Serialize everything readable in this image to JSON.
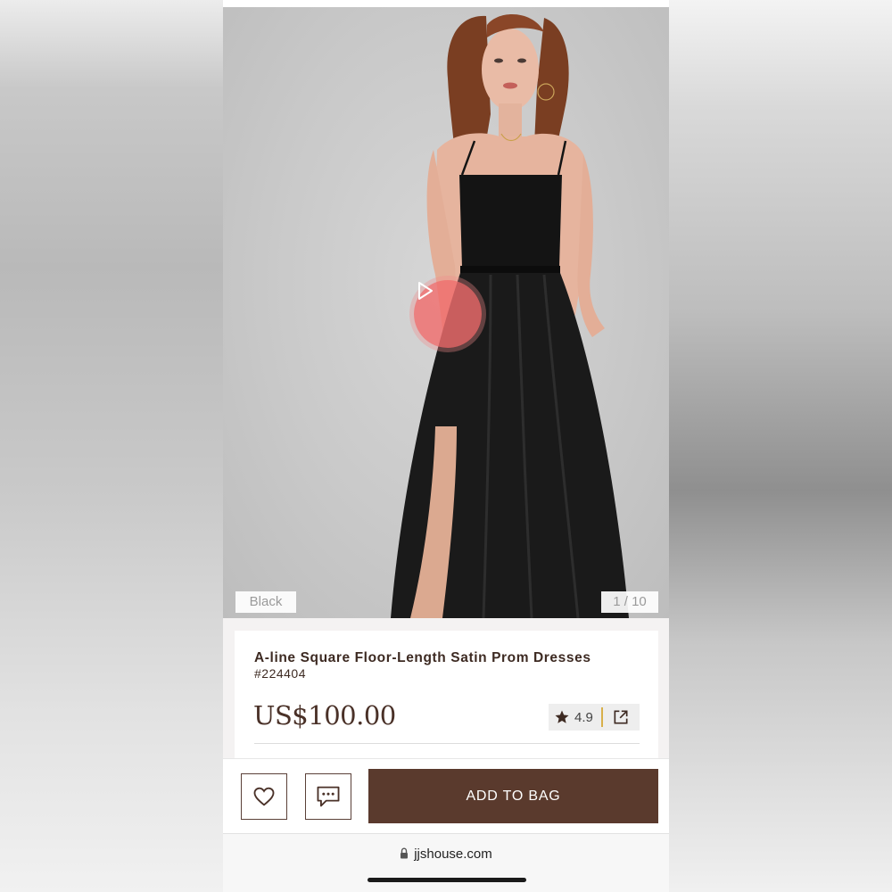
{
  "gallery": {
    "color_label": "Black",
    "counter": "1 / 10",
    "play_icon": "play-icon"
  },
  "product": {
    "title": "A-line Square Floor-Length Satin Prom Dresses",
    "sku": "#224404",
    "price": "US$100.00",
    "rating": "4.9",
    "rating_icon": "star-icon",
    "share_icon": "share-icon"
  },
  "actions": {
    "wishlist_icon": "heart-icon",
    "chat_icon": "chat-icon",
    "add_to_bag_label": "ADD TO BAG"
  },
  "browser": {
    "url": "jjshouse.com",
    "lock_icon": "lock-icon"
  },
  "colors": {
    "brand": "#5a3a2d",
    "text": "#3d2a22",
    "rating_divider": "#d8b04a",
    "play_button": "#f06e6e"
  }
}
